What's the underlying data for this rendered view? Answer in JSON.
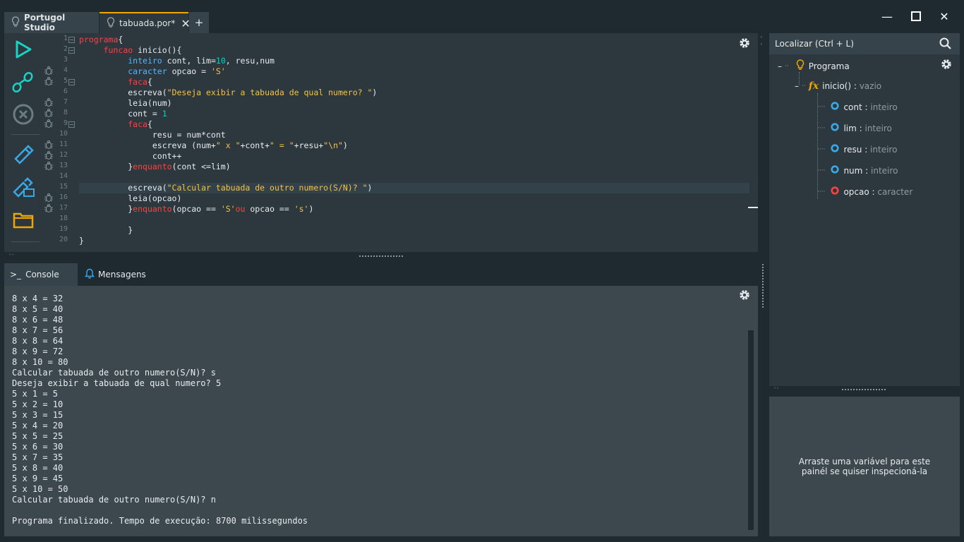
{
  "tabs": {
    "studio_label": "Portugol Studio",
    "file_label": "tabuada.por*",
    "add_label": "+"
  },
  "window": {
    "minimize": "—",
    "maximize": "☐",
    "close": "✕"
  },
  "colors": {
    "accent": "#f0a500",
    "run": "#19d3c5",
    "tool": "#3aa8e8",
    "keyword": "#ff4040",
    "type": "#58b4ff",
    "string": "#f5c244",
    "number": "#00d5c0"
  },
  "toolbar": {
    "icons": [
      "play-icon",
      "debug-steps-icon",
      "stop-icon",
      "usb-icon",
      "usb-config-icon",
      "folder-icon"
    ]
  },
  "editor": {
    "line_numbers": [
      "1",
      "2",
      "3",
      "4",
      "5",
      "6",
      "7",
      "8",
      "9",
      "10",
      "11",
      "12",
      "13",
      "14",
      "15",
      "16",
      "17",
      "18",
      "19",
      "20"
    ],
    "highlighted_line": 15
  },
  "console": {
    "tab_console": "Console",
    "tab_console_prompt": ">_",
    "tab_messages": "Mensagens",
    "lines": [
      "8 x 4 = 32",
      "8 x 5 = 40",
      "8 x 6 = 48",
      "8 x 7 = 56",
      "8 x 8 = 64",
      "8 x 9 = 72",
      "8 x 10 = 80",
      "Calcular tabuada de outro numero(S/N)? s",
      "Deseja exibir a tabuada de qual numero? 5",
      "5 x 1 = 5",
      "5 x 2 = 10",
      "5 x 3 = 15",
      "5 x 4 = 20",
      "5 x 5 = 25",
      "5 x 6 = 30",
      "5 x 7 = 35",
      "5 x 8 = 40",
      "5 x 9 = 45",
      "5 x 10 = 50",
      "Calcular tabuada de outro numero(S/N)? n",
      "",
      "Programa finalizado. Tempo de execução: 8700 milissegundos"
    ]
  },
  "outline": {
    "search_placeholder": "Localizar (Ctrl + L)",
    "program": "Programa",
    "func_name": "inicio()",
    "func_sep": " : ",
    "func_type": "vazio",
    "vars": [
      {
        "name": "cont",
        "sep": " : ",
        "type": "inteiro"
      },
      {
        "name": "lim",
        "sep": " : ",
        "type": "inteiro"
      },
      {
        "name": "resu",
        "sep": " : ",
        "type": "inteiro"
      },
      {
        "name": "num",
        "sep": " : ",
        "type": "inteiro"
      },
      {
        "name": "opcao",
        "sep": " : ",
        "type": "caracter"
      }
    ]
  },
  "inspector": {
    "line1": "Arraste uma variável para este",
    "line2": "painél se quiser inspecioná-la"
  }
}
